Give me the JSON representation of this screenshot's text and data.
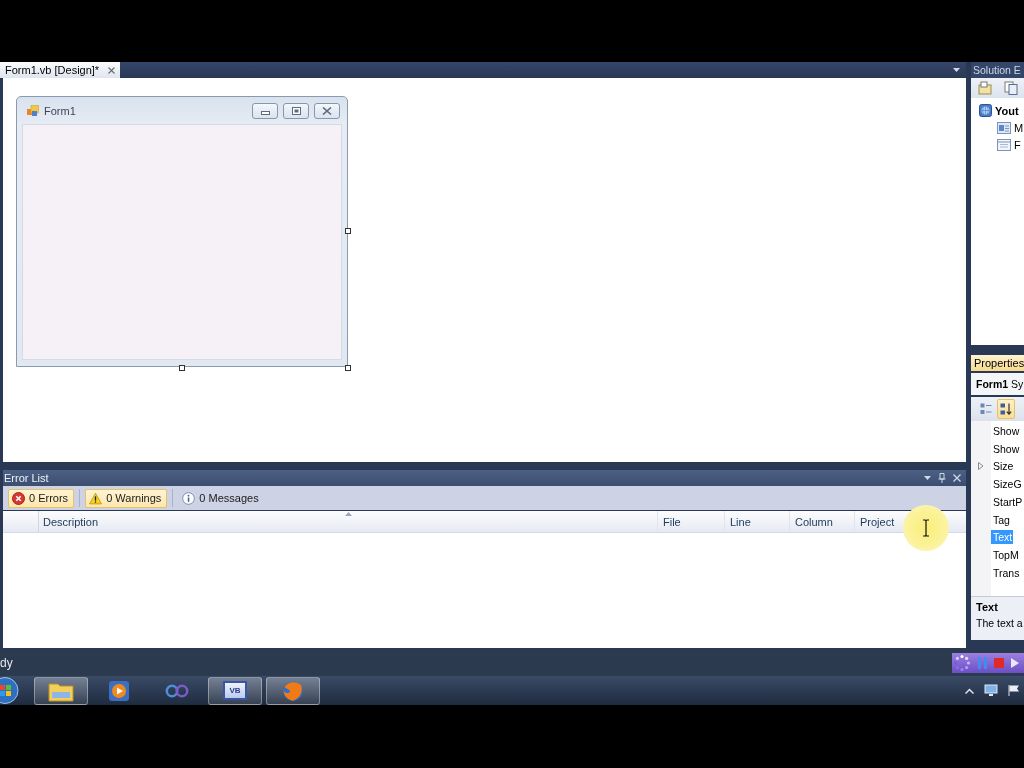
{
  "document_tabs": [
    {
      "label": "Form1.vb [Design]*",
      "selected": true
    }
  ],
  "form_designer": {
    "title": "Form1"
  },
  "error_list": {
    "title": "Error List",
    "filters": [
      {
        "kind": "error",
        "label": "0 Errors",
        "selected": true
      },
      {
        "kind": "warning",
        "label": "0 Warnings",
        "selected": true
      },
      {
        "kind": "message",
        "label": "0 Messages",
        "selected": false
      }
    ],
    "columns": [
      "Description",
      "File",
      "Line",
      "Column",
      "Project"
    ]
  },
  "solution_explorer": {
    "title": "Solution E",
    "tree": [
      {
        "kind": "project",
        "label": "Yout",
        "children": [
          {
            "kind": "settings",
            "label": "M"
          },
          {
            "kind": "form",
            "label": "F"
          }
        ]
      }
    ]
  },
  "properties": {
    "title": "Properties",
    "object_name": "Form1",
    "object_type": "Sy",
    "toolbar": [
      {
        "kind": "categorized",
        "selected": false
      },
      {
        "kind": "alphabetical",
        "selected": true
      }
    ],
    "rows": [
      {
        "kind": "simple",
        "name": "Show",
        "selected": false
      },
      {
        "kind": "simple",
        "name": "Show",
        "selected": false
      },
      {
        "kind": "group",
        "name": "Size",
        "expanded": false,
        "selected": false
      },
      {
        "kind": "simple",
        "name": "SizeG",
        "selected": false
      },
      {
        "kind": "simple",
        "name": "StartP",
        "selected": false
      },
      {
        "kind": "simple",
        "name": "Tag",
        "selected": false
      },
      {
        "kind": "simple",
        "name": "Text",
        "selected": true
      },
      {
        "kind": "simple",
        "name": "TopM",
        "selected": false
      },
      {
        "kind": "simple",
        "name": "Trans",
        "selected": false
      }
    ],
    "description": {
      "title": "Text",
      "text": "The text a"
    }
  },
  "status_bar": {
    "text": "dy"
  },
  "taskbar": {
    "items": [
      {
        "kind": "folder",
        "running": true
      },
      {
        "kind": "media",
        "running": false
      },
      {
        "kind": "rings",
        "running": false
      },
      {
        "kind": "vb",
        "label": "VB",
        "running": true
      },
      {
        "kind": "browser",
        "running": true
      }
    ]
  }
}
